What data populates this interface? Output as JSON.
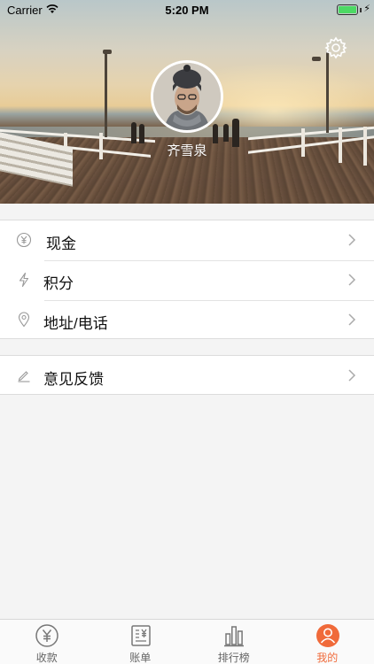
{
  "status_bar": {
    "carrier": "Carrier",
    "time": "5:20 PM"
  },
  "profile": {
    "username": "齐雪泉"
  },
  "menu": {
    "group1": [
      {
        "label": "现金",
        "icon": "yen-circle-icon"
      },
      {
        "label": "积分",
        "icon": "lightning-icon"
      },
      {
        "label": "地址/电话",
        "icon": "location-pin-icon"
      }
    ],
    "group2": [
      {
        "label": "意见反馈",
        "icon": "pencil-icon"
      }
    ]
  },
  "tabbar": {
    "tabs": [
      {
        "label": "收款",
        "icon": "yen-coin-icon",
        "active": false
      },
      {
        "label": "账单",
        "icon": "bill-icon",
        "active": false
      },
      {
        "label": "排行榜",
        "icon": "bar-chart-icon",
        "active": false
      },
      {
        "label": "我的",
        "icon": "user-circle-icon",
        "active": true
      }
    ],
    "active_color": "#f06a3a",
    "inactive_color": "#666666"
  }
}
